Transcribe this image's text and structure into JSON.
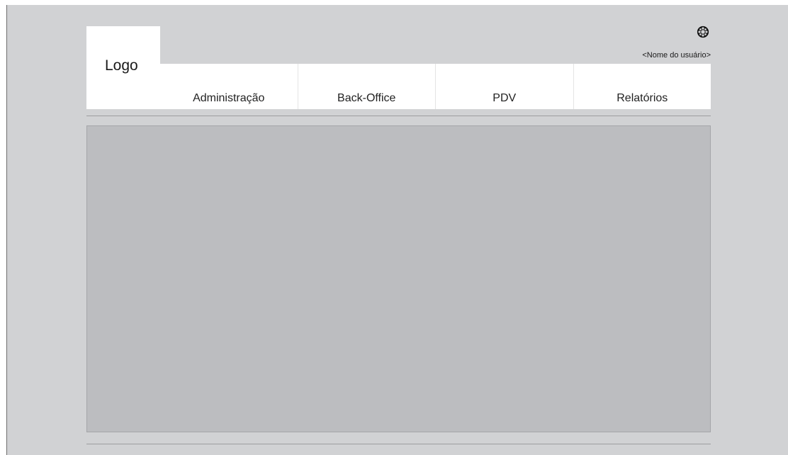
{
  "header": {
    "logo_text": "Logo",
    "username": "<Nome do usuário>",
    "settings_icon": "gear-icon"
  },
  "nav": {
    "items": [
      {
        "label": "Administração"
      },
      {
        "label": "Back-Office"
      },
      {
        "label": "PDV"
      },
      {
        "label": "Relatórios"
      }
    ]
  },
  "colors": {
    "page_background": "#d1d2d4",
    "content_area": "#bcbdc0",
    "nav_background": "#ffffff",
    "left_rule": "#6e6e6e"
  }
}
